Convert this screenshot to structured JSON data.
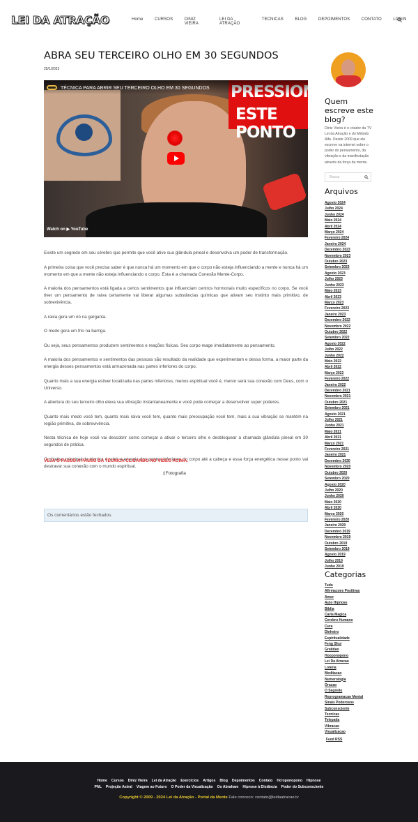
{
  "header": {
    "logo": "LEI DA ATRAÇÃO",
    "nav": [
      "Home",
      "CURSOS",
      "DINIZ VIEIRA",
      "LEI DA ATRAÇÃO",
      "TECNICAS",
      "BLOG",
      "DEPOIMENTOS",
      "CONTATO",
      "LOGIN"
    ]
  },
  "post": {
    "title": "ABRA SEU TERCEIRO OLHO EM 30 SEGUNDOS",
    "date": "25/1/2023",
    "video": {
      "title": "TÉCNICA PARA ABRIR SEU TERCEIRO OLHO EM 30 SEGUNDOS",
      "overlay_line1": "PRESSIONE",
      "overlay_line2": "ESTE PONTO",
      "watch_on": "Watch on ▶ YouTube"
    },
    "paragraphs": [
      "Existe um segredo em seu cérebro que permite que você ative sua glândula pineal e desenvolva um poder de transformação.",
      "A primeira coisa que você precisa saber é que nunca há um momento em que o corpo não esteja influenciando a mente e nunca há um momento em que a mente não esteja influenciando o corpo. Esta é a chamada Conexão Mente-Corpo.",
      "A maioria dos pensamentos está ligada a certos sentimentos que influenciam centros hormonais muito específicos no corpo. Se você tiver um pensamento de raiva certamente vai liberar algumas substâncias químicas que ativam seu instinto mais primitivo, de sobrevivência.",
      "A raiva gera um nó na garganta.",
      "O medo gera um frio na barriga.",
      "Ou seja, seus pensamentos produzem sentimentos e reações físicas. Seu corpo reage imediatamente ao pensamento.",
      "A maioria dos pensamentos e sentimentos das pessoas são resultado da realidade que experimentam e dessa forma, a maior parte da energia desses pensamentos está armazenada nas partes inferiores do corpo.",
      "Quanto mais a sua energia estiver localizada nas partes inferiores, menos espiritual você é, menor será sua conexão com Deus, com o Universo.",
      "A abertura do seu terceiro olho eleva sua vibração instantaneamente e você pode começar a desenvolver super poderes.",
      "Quanto mais medo você tem, quanto mais raiva você tem, quanto mais preocupação você tem, mais a sua vibração se mantém na região primitiva, de sobrevivência.",
      "Nesta técnica de hoje você vai descobrir como começar a ativar o terceiro olho e desbloquear a chamada glândula pineal em 30 segundos de prática.",
      "O objetivo principal da técnica é subir a energia dos pontos inferiores do corpo até a cabeça e essa força energética nesse ponto vai destravar sua conexão com o mundo espiritual."
    ],
    "cta": "VEJA O PASSO A PASSO DA TÉCNICA CLICANDO NO VÍDEO ACIMA.",
    "image_alt": "Fotografia",
    "comments_closed": "Os comentários estão fechados."
  },
  "sidebar": {
    "author_heading": "Quem escreve este blog?",
    "author_desc": "Diniz Vieira é o criador da TV Lei da Atração e do Método Alfa. Desde 2009 que ele escreve na internet sobre o poder do pensamento, da vibração e da manifestação através da força da mente.",
    "search_placeholder": "Busca",
    "archives_heading": "Arquivos",
    "archives": [
      "Agosto 2024",
      "Julho 2024",
      "Junho 2024",
      "Maio 2024",
      "Abril 2024",
      "Março 2024",
      "Fevereiro 2024",
      "Janeiro 2024",
      "Dezembro 2023",
      "Novembro 2023",
      "Outubro 2023",
      "Setembro 2023",
      "Agosto 2023",
      "Julho 2023",
      "Junho 2023",
      "Maio 2023",
      "Abril 2023",
      "Março 2023",
      "Fevereiro 2023",
      "Janeiro 2023",
      "Dezembro 2022",
      "Novembro 2022",
      "Outubro 2022",
      "Setembro 2022",
      "Agosto 2022",
      "Julho 2022",
      "Junho 2022",
      "Maio 2022",
      "Abril 2022",
      "Março 2022",
      "Fevereiro 2022",
      "Janeiro 2022",
      "Dezembro 2021",
      "Novembro 2021",
      "Outubro 2021",
      "Setembro 2021",
      "Agosto 2021",
      "Julho 2021",
      "Junho 2021",
      "Maio 2021",
      "Abril 2021",
      "Março 2021",
      "Fevereiro 2021",
      "Janeiro 2021",
      "Dezembro 2020",
      "Novembro 2020",
      "Outubro 2020",
      "Setembro 2020",
      "Agosto 2020",
      "Julho 2020",
      "Junho 2020",
      "Maio 2020",
      "Abril 2020",
      "Março 2020",
      "Fevereiro 2020",
      "Janeiro 2020",
      "Dezembro 2019",
      "Novembro 2019",
      "Outubro 2019",
      "Setembro 2019",
      "Agosto 2019",
      "Julho 2019",
      "Junho 2019"
    ],
    "categories_heading": "Categorias",
    "categories": [
      "Tudo",
      "Afirmacoes Positivas",
      "Amor",
      "Auto Hipnose",
      "Biblia",
      "Carta Magica",
      "Cerebro Humano",
      "Cura",
      "Dinheiro",
      "Espiritualidade",
      "Feng Shui",
      "Gratidao",
      "Hooponopono",
      "Lei Da Atracao",
      "Loteria",
      "Meditacao",
      "Numerologia",
      "Oracao",
      "O Segredo",
      "Reprogramacao Mental",
      "Sinais Poderosos",
      "Subconsciente",
      "Tecnicas",
      "Telepatia",
      "Vibracao",
      "Visualizacao"
    ],
    "feed": "Feed RSS"
  },
  "footer": {
    "links_row1": [
      "Home",
      "Cursos",
      "Diniz Vieira",
      "Lei da Atração",
      "Exercícios",
      "Artigos",
      "Blog",
      "Depoimentos",
      "Contato",
      "Ho'oponopono",
      "Hipnose"
    ],
    "links_row2": [
      "PNL",
      "Projeção Astral",
      "Viagem ao Futuro",
      "O Poder da Visualização",
      "Os Abraham",
      "Hipnose à Distância",
      "Poder do Subconsciente"
    ],
    "copyright": "Copyright © 2009 - 2024 Lei da Atração - Portal da Mente",
    "contact": "Fale conosco: contato@leidaatracao.tv"
  }
}
